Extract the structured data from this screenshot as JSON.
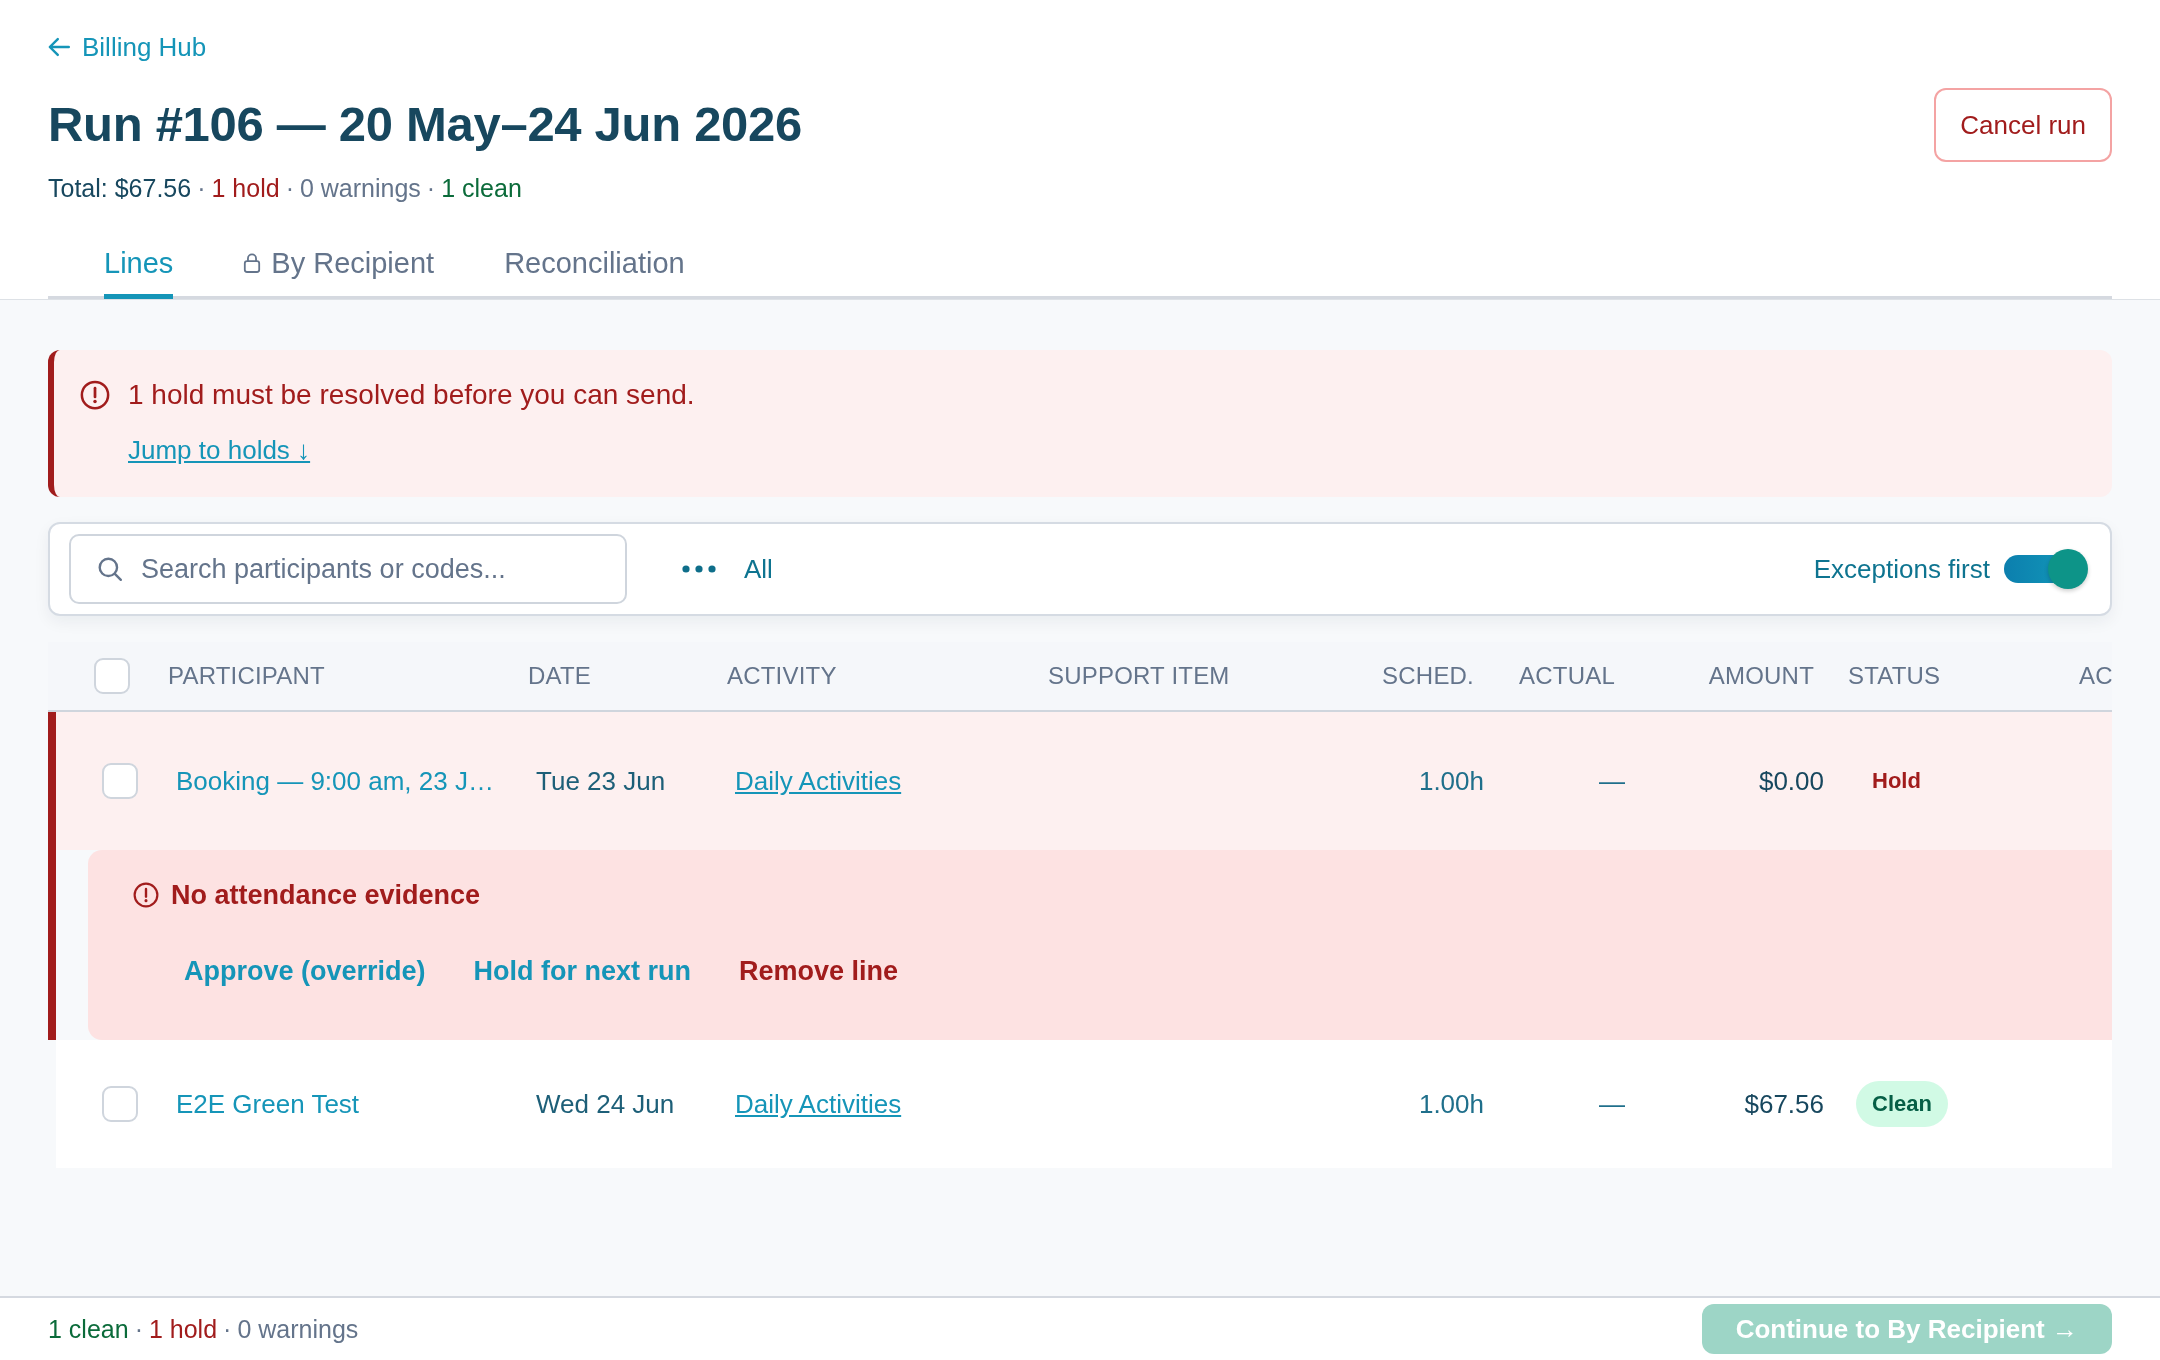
{
  "back_link": {
    "label": "Billing Hub"
  },
  "header": {
    "title": "Run #106 — 20 May–24 Jun 2026",
    "summary": [
      {
        "text": "Total: $67.56",
        "kind": "total"
      },
      {
        "text": "·",
        "kind": "separator"
      },
      {
        "text": "1 hold",
        "kind": "hold"
      },
      {
        "text": "·",
        "kind": "separator"
      },
      {
        "text": "0 warnings",
        "kind": "warning"
      },
      {
        "text": "·",
        "kind": "separator"
      },
      {
        "text": "1 clean",
        "kind": "clean"
      }
    ],
    "cancel_button": {
      "label": "Cancel run"
    }
  },
  "tabs": [
    {
      "label": "Lines",
      "selected": true,
      "locked": false
    },
    {
      "label": "By Recipient",
      "selected": false,
      "locked": true
    },
    {
      "label": "Reconciliation",
      "selected": false,
      "locked": false
    }
  ],
  "alert": {
    "message": "1 hold must be resolved before you can send.",
    "link": "Jump to holds ↓"
  },
  "toolbar": {
    "search": {
      "placeholder": "Search participants or codes..."
    },
    "filter": {
      "label": "All"
    },
    "exceptions_first": {
      "label": "Exceptions first",
      "on": true
    }
  },
  "table": {
    "select_all": {
      "checked": false
    },
    "columns": [
      "PARTICIPANT",
      "DATE",
      "ACTIVITY",
      "SUPPORT ITEM",
      "SCHED.",
      "ACTUAL",
      "AMOUNT",
      "STATUS",
      "AC"
    ],
    "rows": [
      {
        "checked": false,
        "participant": "Booking — 9:00 am, 23 J…",
        "date": "Tue 23 Jun",
        "activity": "Daily Activities",
        "sched": "1.00h",
        "actual": "—",
        "amount": "$0.00",
        "status": {
          "label": "Hold",
          "kind": "hold"
        },
        "issue": {
          "message": "No attendance evidence",
          "actions": [
            {
              "label": "Approve (override)",
              "kind": "link"
            },
            {
              "label": "Hold for next run",
              "kind": "link"
            },
            {
              "label": "Remove line",
              "kind": "danger"
            }
          ]
        }
      },
      {
        "checked": false,
        "participant": "E2E Green Test",
        "date": "Wed 24 Jun",
        "activity": "Daily Activities",
        "sched": "1.00h",
        "actual": "—",
        "amount": "$67.56",
        "status": {
          "label": "Clean",
          "kind": "clean"
        }
      }
    ]
  },
  "footer": {
    "summary": [
      {
        "text": "1 clean",
        "kind": "clean"
      },
      {
        "text": "·",
        "kind": "separator"
      },
      {
        "text": "1 hold",
        "kind": "hold"
      },
      {
        "text": "·",
        "kind": "separator"
      },
      {
        "text": "0 warnings",
        "kind": "warning"
      }
    ],
    "continue_button": {
      "label": "Continue to By Recipient →",
      "disabled": true
    }
  }
}
